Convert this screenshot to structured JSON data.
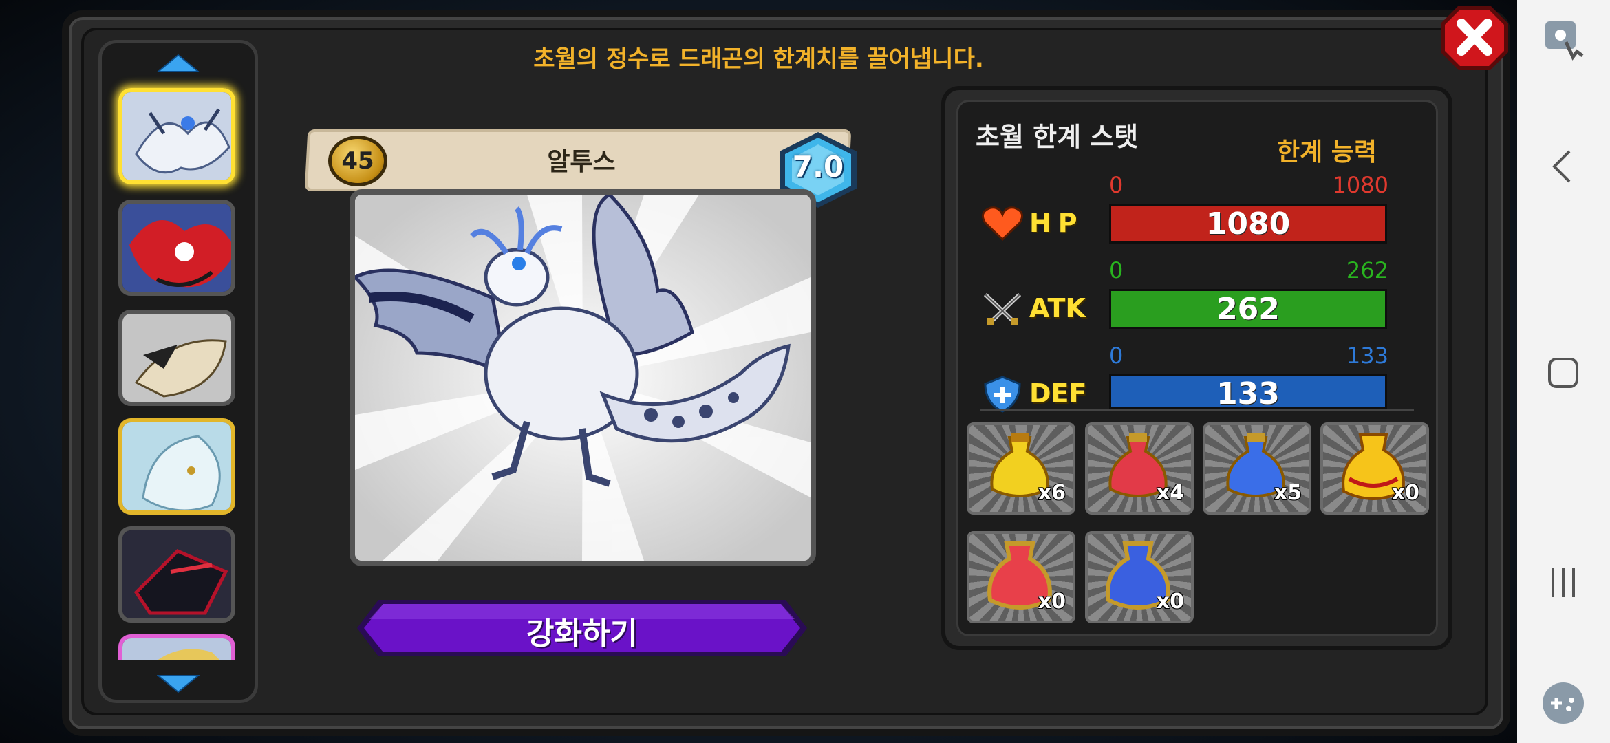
{
  "header": {
    "message": "초월의 정수로 드래곤의 한계치를 끌어냅니다."
  },
  "dragon_list": {
    "items": [
      {
        "name": "white-griffin-dragon",
        "frame": "selected"
      },
      {
        "name": "red-dragon",
        "frame": "normal"
      },
      {
        "name": "bone-dragon",
        "frame": "normal"
      },
      {
        "name": "ice-dragon",
        "frame": "gold"
      },
      {
        "name": "dark-dragon",
        "frame": "normal"
      },
      {
        "name": "partial-dragon",
        "frame": "pink"
      }
    ]
  },
  "dragon": {
    "level": "45",
    "name": "알투스",
    "grade": "7.0"
  },
  "enhance_button": {
    "label": "강화하기"
  },
  "stats": {
    "title": "초월 한계 스탯",
    "subtitle": "한계 능력",
    "hp": {
      "label": "HP",
      "min": "0",
      "max": "1080",
      "value": "1080",
      "fill": 1.0,
      "color": "#c1231b",
      "max_color": "#e0392e"
    },
    "atk": {
      "label": "ATK",
      "min": "0",
      "max": "262",
      "value": "262",
      "fill": 1.0,
      "color": "#2a9e1f",
      "max_color": "#29b41f"
    },
    "def": {
      "label": "DEF",
      "min": "0",
      "max": "133",
      "value": "133",
      "fill": 1.0,
      "color": "#1e5fb8",
      "max_color": "#2e7ad8"
    }
  },
  "items": [
    {
      "name": "gold-potion-small",
      "count": "x6"
    },
    {
      "name": "red-potion-small",
      "count": "x4"
    },
    {
      "name": "blue-potion-small",
      "count": "x5"
    },
    {
      "name": "gold-potion-large",
      "count": "x0"
    },
    {
      "name": "red-potion-large",
      "count": "x0"
    },
    {
      "name": "blue-potion-large",
      "count": "x0"
    }
  ],
  "colors": {
    "accent": "#f2b22a",
    "enhance": "#6a12c8",
    "close": "#d0161c"
  }
}
